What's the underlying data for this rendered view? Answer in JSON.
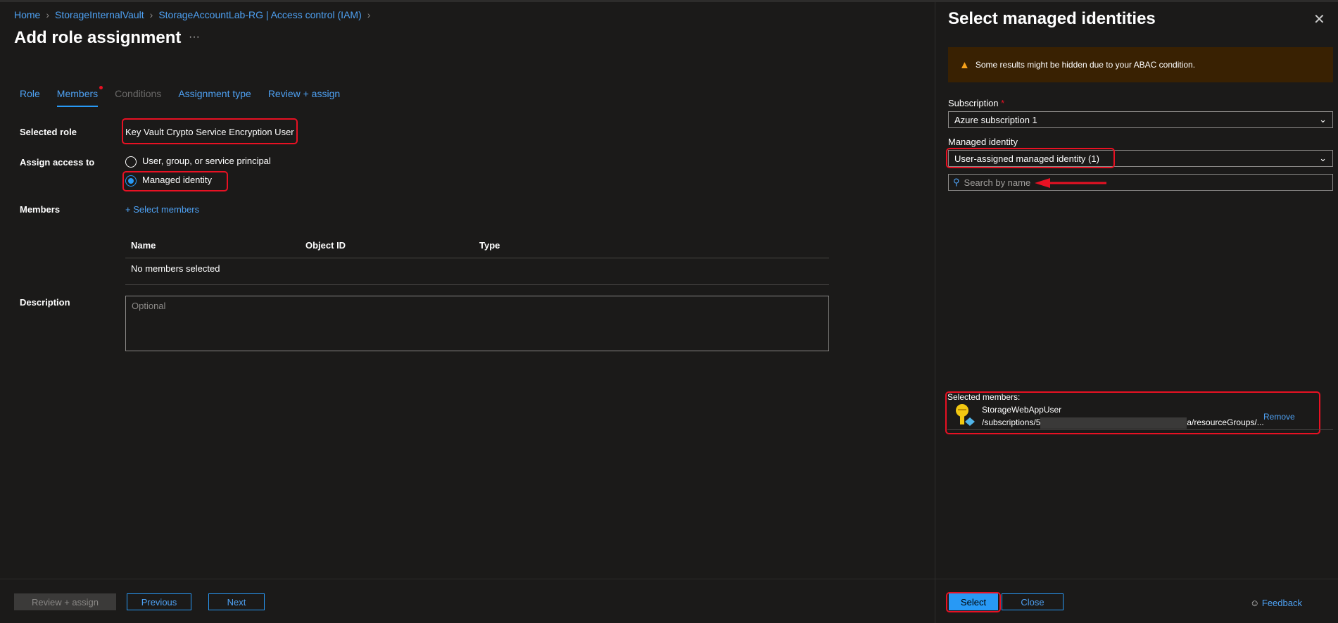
{
  "breadcrumb": [
    "Home",
    "StorageInternalVault",
    "StorageAccountLab-RG | Access control (IAM)"
  ],
  "page_title": "Add role assignment",
  "more_label": "···",
  "tabs": [
    {
      "label": "Role"
    },
    {
      "label": "Members"
    },
    {
      "label": "Conditions"
    },
    {
      "label": "Assignment type"
    },
    {
      "label": "Review + assign"
    }
  ],
  "form": {
    "selected_role_label": "Selected role",
    "selected_role_value": "Key Vault Crypto Service Encryption User",
    "assign_access_label": "Assign access to",
    "option_user": "User, group, or service principal",
    "option_managed": "Managed identity",
    "members_label": "Members",
    "select_members": "Select members",
    "table_headers": [
      "Name",
      "Object ID",
      "Type"
    ],
    "table_empty": "No members selected",
    "description_label": "Description",
    "description_placeholder": "Optional"
  },
  "footer": {
    "review": "Review + assign",
    "previous": "Previous",
    "next": "Next"
  },
  "panel": {
    "title": "Select managed identities",
    "warning": "Some results might be hidden due to your ABAC condition.",
    "subscription_label": "Subscription",
    "required": "*",
    "subscription_value": "Azure subscription 1",
    "mi_label": "Managed identity",
    "mi_value": "User-assigned managed identity (1)",
    "search_placeholder": "Search by name",
    "selected_label": "Selected members:",
    "member_name": "StorageWebAppUser",
    "member_path_start": "/subscriptions/5",
    "member_path_end": "a/resourceGroups/...",
    "remove": "Remove",
    "select": "Select",
    "close": "Close",
    "feedback": "Feedback"
  }
}
